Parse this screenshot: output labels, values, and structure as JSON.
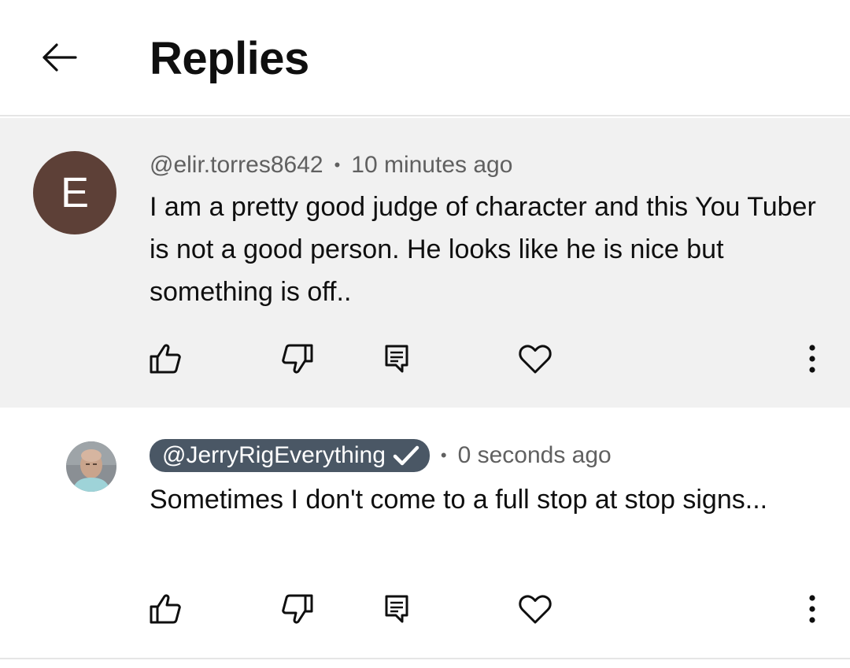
{
  "header": {
    "title": "Replies",
    "back_icon": "arrow-left-icon"
  },
  "comments": [
    {
      "avatar_letter": "E",
      "avatar_color": "#5d4037",
      "author": "@elir.torres8642",
      "separator": "•",
      "time": "10 minutes ago",
      "text": "I am a pretty good judge of character and this You Tuber is not a good person. He looks like he is nice but something is off..",
      "background": "#f1f1f1"
    },
    {
      "avatar": "profile-photo",
      "author": "@JerryRigEverything",
      "verified": true,
      "separator": "•",
      "time": "0 seconds ago",
      "text": "Sometimes I don't come to a full stop at stop signs...",
      "background": "#ffffff"
    }
  ],
  "action_icons": [
    "thumbs-up-icon",
    "thumbs-down-icon",
    "reply-icon",
    "heart-icon",
    "more-vert-icon"
  ],
  "colors": {
    "text_primary": "#0f0f0f",
    "text_secondary": "#606060",
    "verified_chip": "#4a5765",
    "divider": "#e5e5e5"
  }
}
